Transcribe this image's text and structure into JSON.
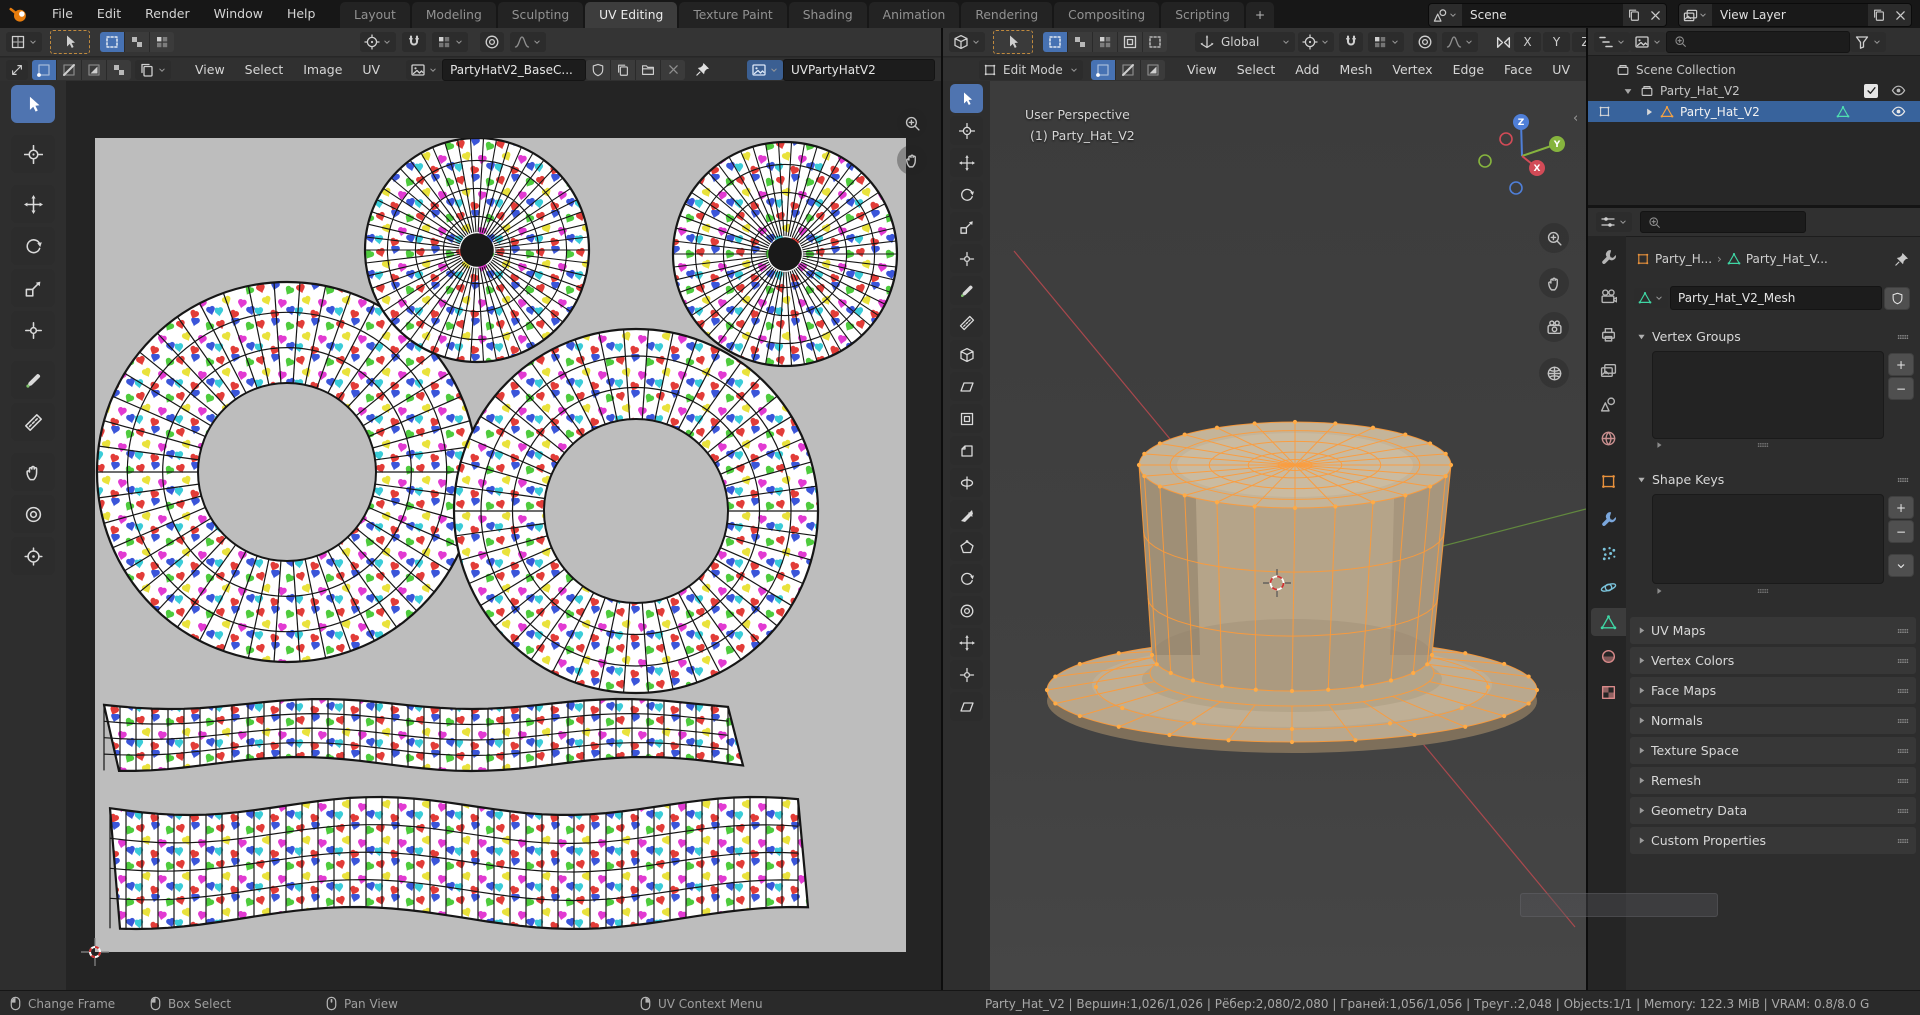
{
  "topbar": {
    "menus": [
      "File",
      "Edit",
      "Render",
      "Window",
      "Help"
    ],
    "workspaces": [
      "Layout",
      "Modeling",
      "Sculpting",
      "UV Editing",
      "Texture Paint",
      "Shading",
      "Animation",
      "Rendering",
      "Compositing",
      "Scripting"
    ],
    "active_workspace": "UV Editing",
    "new_workspace_button": "+",
    "scene_field": {
      "value": "Scene"
    },
    "view_layer_field": {
      "value": "View Layer"
    }
  },
  "uv_editor": {
    "menus": [
      "View",
      "Select",
      "Image",
      "UV"
    ],
    "image_name": "PartyHatV2_BaseC...",
    "uv_map_name": "UVPartyHatV2",
    "tools": [
      {
        "name": "tweak",
        "icon": "arrow",
        "active": true
      },
      {
        "name": "cursor",
        "icon": "cross",
        "gap": true
      },
      {
        "name": "move",
        "icon": "move",
        "gap": true
      },
      {
        "name": "rotate",
        "icon": "rotate"
      },
      {
        "name": "scale",
        "icon": "scale"
      },
      {
        "name": "transform",
        "icon": "transform"
      },
      {
        "name": "annotate",
        "icon": "pen",
        "gap": true
      },
      {
        "name": "measure",
        "icon": "ruler"
      },
      {
        "name": "grab",
        "icon": "hand",
        "gap": true
      },
      {
        "name": "relax",
        "icon": "prop"
      },
      {
        "name": "pinch",
        "icon": "pivot"
      }
    ]
  },
  "viewport": {
    "mode_label": "Edit Mode",
    "orientation_label": "Global",
    "menus": [
      "View",
      "Select",
      "Add",
      "Mesh",
      "Vertex",
      "Edge",
      "Face",
      "UV"
    ],
    "overlay_line1": "User Perspective",
    "overlay_line2": "(1) Party_Hat_V2",
    "axis_labels": {
      "x": "X",
      "y": "Y",
      "z": "Z"
    },
    "mirror_labels": [
      "X",
      "Y",
      "Z"
    ],
    "tools": [
      {
        "name": "tweak",
        "icon": "arrow",
        "active": true
      },
      {
        "name": "cursor",
        "icon": "cross",
        "gap": true
      },
      {
        "name": "move",
        "icon": "move",
        "gap": true
      },
      {
        "name": "rotate",
        "icon": "rotate"
      },
      {
        "name": "scale",
        "icon": "scale"
      },
      {
        "name": "transform",
        "icon": "transform"
      },
      {
        "name": "annotate",
        "icon": "pen",
        "gap": true
      },
      {
        "name": "measure",
        "icon": "ruler"
      },
      {
        "name": "add-cube",
        "icon": "cube",
        "gap": true
      },
      {
        "name": "extrude-region",
        "icon": "para"
      },
      {
        "name": "inset-faces",
        "icon": "inset"
      },
      {
        "name": "bevel",
        "icon": "corner"
      },
      {
        "name": "loop-cut",
        "icon": "loop"
      },
      {
        "name": "knife",
        "icon": "knife"
      },
      {
        "name": "poly-build",
        "icon": "poly"
      },
      {
        "name": "spin",
        "icon": "rotate"
      },
      {
        "name": "smooth",
        "icon": "prop"
      },
      {
        "name": "edge-slide",
        "icon": "move"
      },
      {
        "name": "shrink-fatten",
        "icon": "transform"
      },
      {
        "name": "shear",
        "icon": "para"
      }
    ]
  },
  "outliner": {
    "root_label": "Scene Collection",
    "collection_label": "Party_Hat_V2",
    "object_label": "Party_Hat_V2"
  },
  "properties": {
    "tabs": [
      {
        "name": "tool",
        "icon": "wrench",
        "color": "#b5b5b5"
      },
      {
        "name": "render",
        "icon": "rendercam",
        "color": "#b5b5b5"
      },
      {
        "name": "output",
        "icon": "printer",
        "color": "#b5b5b5"
      },
      {
        "name": "view-layer",
        "icon": "imgs",
        "color": "#b5b5b5"
      },
      {
        "name": "scene",
        "icon": "scenec",
        "color": "#b5b5b5"
      },
      {
        "name": "world",
        "icon": "world",
        "color": "#c98f8f"
      },
      {
        "name": "object",
        "icon": "objsq",
        "color": "#e8913c"
      },
      {
        "name": "modifiers",
        "icon": "wrench",
        "color": "#7ba7dc"
      },
      {
        "name": "particles",
        "icon": "particles",
        "color": "#7bc4dc"
      },
      {
        "name": "physics",
        "icon": "physics",
        "color": "#7bc4dc"
      },
      {
        "name": "object-data",
        "icon": "meshtri",
        "color": "#3fd6a4",
        "active": true
      },
      {
        "name": "material",
        "icon": "matsphere",
        "color": "#d98a8a"
      },
      {
        "name": "texture",
        "icon": "texchk",
        "color": "#d98a8a"
      }
    ],
    "breadcrumb_object": "Party_H...",
    "breadcrumb_data": "Party_Hat_V...",
    "mesh_name": "Party_Hat_V2_Mesh",
    "list_panels": [
      {
        "label": "Vertex Groups"
      },
      {
        "label": "Shape Keys"
      }
    ],
    "collapsed_panels": [
      "UV Maps",
      "Vertex Colors",
      "Face Maps",
      "Normals",
      "Texture Space",
      "Remesh",
      "Geometry Data",
      "Custom Properties"
    ]
  },
  "statusbar": {
    "hints": [
      {
        "icon": "mousel",
        "label": "Change Frame"
      },
      {
        "icon": "mousel",
        "label": "Box Select"
      },
      {
        "icon": "mousem",
        "label": "Pan View"
      },
      {
        "icon": "mouser",
        "label": "UV Context Menu"
      }
    ],
    "stats": "Party_Hat_V2 | Вершин:1,026/1,026 | Рёбер:2,080/2,080 | Граней:1,056/1,056 | Треуг.:2,048 | Objects:1/1 | Memory: 122.3 MiB | VRAM: 0.8/8.0 G"
  },
  "colors": {
    "accent": "#4772b3",
    "object_orange": "#e8913c",
    "mesh_green": "#3fd6a4",
    "wire_orange": "#ff9b38"
  }
}
